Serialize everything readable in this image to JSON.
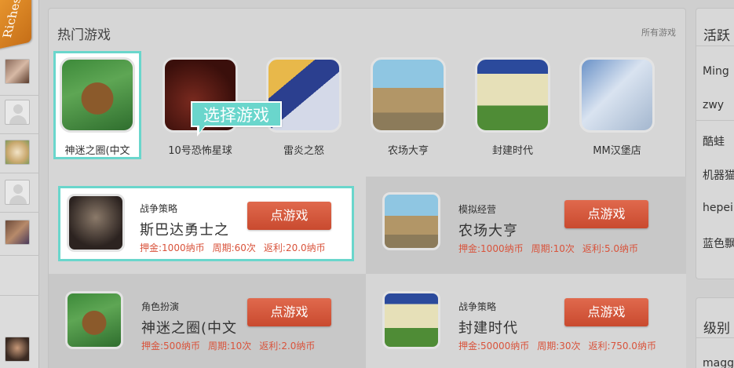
{
  "left_strip": {
    "ribbon_text": "Riches"
  },
  "main": {
    "title": "热门游戏",
    "all_games_link": "所有游戏",
    "tooltip": "选择游戏",
    "games": [
      {
        "name": "神迷之圈(中文",
        "icon": "maze-game-icon",
        "selected": true
      },
      {
        "name": "10号恐怖星球",
        "icon": "horror-game-icon",
        "selected": false
      },
      {
        "name": "雷炎之怒",
        "icon": "thunder-game-icon",
        "selected": false
      },
      {
        "name": "农场大亨",
        "icon": "farm-game-icon",
        "selected": false
      },
      {
        "name": "封建时代",
        "icon": "feudal-game-icon",
        "selected": false
      },
      {
        "name": "MM汉堡店",
        "icon": "burger-game-icon",
        "selected": false
      }
    ],
    "cards": [
      {
        "category": "战争策略",
        "title": "斯巴达勇士之",
        "button": "点游戏",
        "deposit": "押金:1000纳币",
        "period": "周期:60次",
        "rebate": "返利:20.0纳币",
        "selected": true
      },
      {
        "category": "模拟经营",
        "title": "农场大亨",
        "button": "点游戏",
        "deposit": "押金:1000纳币",
        "period": "周期:10次",
        "rebate": "返利:5.0纳币",
        "selected": false
      },
      {
        "category": "角色扮演",
        "title": "神迷之圈(中文",
        "button": "点游戏",
        "deposit": "押金:500纳币",
        "period": "周期:10次",
        "rebate": "返利:2.0纳币",
        "selected": false
      },
      {
        "category": "战争策略",
        "title": "封建时代",
        "button": "点游戏",
        "deposit": "押金:50000纳币",
        "period": "周期:30次",
        "rebate": "返利:750.0纳币",
        "selected": false
      }
    ]
  },
  "right_panel": {
    "active_title": "活跃",
    "users": [
      "Ming",
      "zwy",
      "酷蛙",
      "机器猫",
      "hepei",
      "蓝色飘"
    ],
    "level_title": "级别",
    "level_users": [
      "magg"
    ]
  },
  "colors": {
    "accent": "#6ad6cc",
    "button": "#d9533b",
    "stat_text": "#d9533b",
    "ribbon": "#e8962e"
  }
}
